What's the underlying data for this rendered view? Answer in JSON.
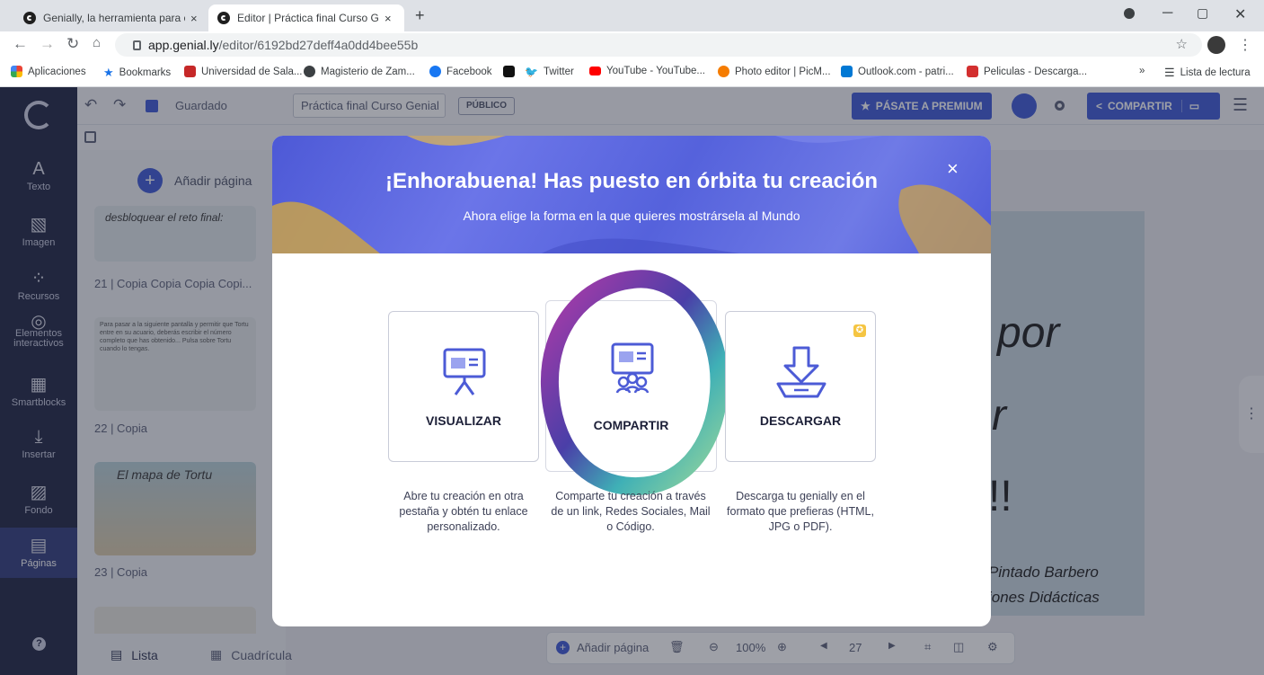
{
  "browser": {
    "tabs": [
      {
        "title": "Genially, la herramienta para cre",
        "close": "×"
      },
      {
        "title": "Editor | Práctica final Curso Geni",
        "close": "×"
      }
    ],
    "new_tab": "+",
    "url_domain": "app.genial.ly",
    "url_path": "/editor/6192bd27deff4a0dd4bee55b",
    "bookmarks": [
      {
        "label": "Aplicaciones",
        "color": "#ea4335"
      },
      {
        "label": "Bookmarks",
        "color": "#1a73e8"
      },
      {
        "label": "Universidad de Sala...",
        "color": "#c62828"
      },
      {
        "label": "Magisterio de Zam...",
        "color": "#3c4043"
      },
      {
        "label": "Facebook",
        "color": "#1877f2"
      },
      {
        "label": "",
        "color": "#111111"
      },
      {
        "label": "Twitter",
        "color": "#1da1f2"
      },
      {
        "label": "YouTube - YouTube...",
        "color": "#ff0000"
      },
      {
        "label": "Photo editor | PicM...",
        "color": "#f57c00"
      },
      {
        "label": "Outlook.com - patri...",
        "color": "#0078d4"
      },
      {
        "label": "Peliculas - Descarga...",
        "color": "#d32f2f"
      }
    ],
    "bookmarks_more": "»",
    "reading_list": "Lista de lectura"
  },
  "editor": {
    "saved_label": "Guardado",
    "title_value": "Práctica final Curso Genial",
    "public_badge": "PÚBLICO",
    "premium_button": "PÁSATE A PREMIUM",
    "share_button": "COMPARTIR",
    "add_page": "Añadir página",
    "nav": [
      {
        "glyph": "A",
        "label": "Texto"
      },
      {
        "glyph": "▧",
        "label": "Imagen"
      },
      {
        "glyph": "⁘",
        "label": "Recursos"
      },
      {
        "glyph": "◎",
        "label": "Elementos interactivos"
      },
      {
        "glyph": "▦",
        "label": "Smartblocks"
      },
      {
        "glyph": "⤓",
        "label": "Insertar"
      },
      {
        "glyph": "▨",
        "label": "Fondo"
      },
      {
        "glyph": "▤",
        "label": "Páginas"
      }
    ],
    "help": "?",
    "pages": [
      {
        "label": "21 | Copia Copia Copia Copi...",
        "thumb_text": "desbloquear el reto final:"
      },
      {
        "label": "22 | Copia",
        "thumb_text": "Para pasar a la siguiente pantalla y permitir que Tortu entre en su acuario, deberás escribir el número completo que has obtenido... Pulsa sobre Tortu cuando lo tengas."
      },
      {
        "label": "23 | Copia",
        "thumb_text": "El mapa de Tortu"
      }
    ],
    "view_tabs": {
      "list": "Lista",
      "grid": "Cuadrícula"
    },
    "bottom": {
      "add_page": "Añadir página",
      "zoom": "100%",
      "page_number": "27"
    },
    "canvas_text": [
      "por",
      "r",
      "!!",
      "Pintado Barbero",
      "iones Didácticas"
    ]
  },
  "modal": {
    "title": "¡Enhorabuena! Has puesto en órbita tu creación",
    "subtitle": "Ahora elige la forma en la que quieres mostrársela al Mundo",
    "close": "×",
    "options": [
      {
        "label": "VISUALIZAR",
        "desc": "Abre tu creación en otra pestaña y obtén tu enlace personalizado.",
        "icon": "presentation-icon"
      },
      {
        "label": "COMPARTIR",
        "desc": "Comparte tu creación a través de un link, Redes Sociales, Mail o Código.",
        "icon": "share-presentation-icon"
      },
      {
        "label": "DESCARGAR",
        "desc": "Descarga tu genially en el formato que prefieras (HTML, JPG o PDF).",
        "icon": "download-icon"
      }
    ],
    "accent": "#4c5bd6",
    "premium_star_color": "#f5c542"
  }
}
